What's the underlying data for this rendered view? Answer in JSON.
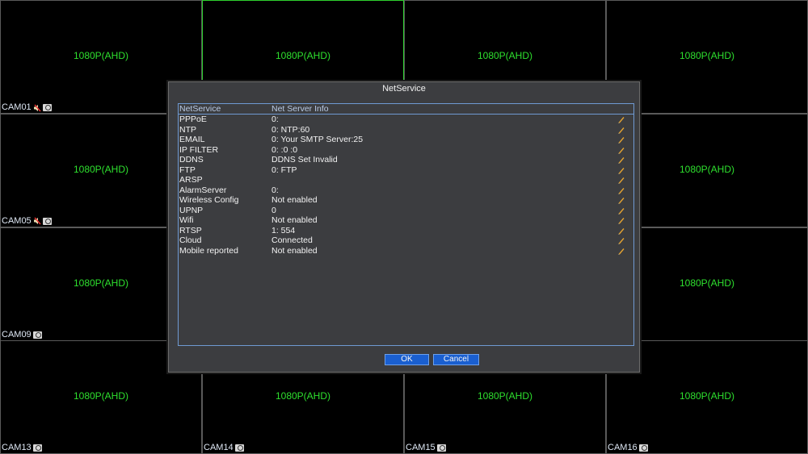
{
  "grid": {
    "cells": [
      {
        "resolution": "1080P(AHD)",
        "label": "CAM01",
        "has_audio_icon": true,
        "active": false
      },
      {
        "resolution": "1080P(AHD)",
        "label": "",
        "has_audio_icon": false,
        "active": true
      },
      {
        "resolution": "1080P(AHD)",
        "label": "",
        "has_audio_icon": false,
        "active": false
      },
      {
        "resolution": "1080P(AHD)",
        "label": "",
        "has_audio_icon": true,
        "active": false
      },
      {
        "resolution": "1080P(AHD)",
        "label": "CAM05",
        "has_audio_icon": true,
        "active": false
      },
      {
        "resolution": "",
        "label": "",
        "has_audio_icon": false,
        "active": false
      },
      {
        "resolution": "",
        "label": "",
        "has_audio_icon": false,
        "active": false
      },
      {
        "resolution": "1080P(AHD)",
        "label": "",
        "has_audio_icon": true,
        "active": false
      },
      {
        "resolution": "1080P(AHD)",
        "label": "CAM09",
        "has_audio_icon": false,
        "active": false
      },
      {
        "resolution": "",
        "label": "",
        "has_audio_icon": false,
        "active": false
      },
      {
        "resolution": "",
        "label": "",
        "has_audio_icon": false,
        "active": false
      },
      {
        "resolution": "1080P(AHD)",
        "label": "",
        "has_audio_icon": false,
        "active": false
      },
      {
        "resolution": "1080P(AHD)",
        "label": "CAM13",
        "has_audio_icon": false,
        "active": false
      },
      {
        "resolution": "1080P(AHD)",
        "label": "CAM14",
        "has_audio_icon": false,
        "active": false
      },
      {
        "resolution": "1080P(AHD)",
        "label": "CAM15",
        "has_audio_icon": false,
        "active": false
      },
      {
        "resolution": "1080P(AHD)",
        "label": "CAM16",
        "has_audio_icon": false,
        "active": false
      }
    ]
  },
  "dialog": {
    "title": "NetService",
    "header": {
      "col1": "NetService",
      "col2": "Net Server Info"
    },
    "rows": [
      {
        "service": "PPPoE",
        "info": "0:"
      },
      {
        "service": "NTP",
        "info": "0: NTP:60"
      },
      {
        "service": "EMAIL",
        "info": "0: Your SMTP Server:25"
      },
      {
        "service": "IP FILTER",
        "info": "0: :0 :0"
      },
      {
        "service": "DDNS",
        "info": "DDNS Set Invalid"
      },
      {
        "service": "FTP",
        "info": "0: FTP"
      },
      {
        "service": "ARSP",
        "info": ""
      },
      {
        "service": "AlarmServer",
        "info": "0:"
      },
      {
        "service": "Wireless Config",
        "info": "Not enabled"
      },
      {
        "service": "UPNP",
        "info": "0"
      },
      {
        "service": "Wifi",
        "info": "Not enabled"
      },
      {
        "service": "RTSP",
        "info": "1: 554"
      },
      {
        "service": "Cloud",
        "info": "Connected"
      },
      {
        "service": "Mobile reported",
        "info": "Not enabled"
      }
    ],
    "ok_label": "OK",
    "cancel_label": "Cancel"
  },
  "icons": {
    "edit": "pencil-icon",
    "audio": "mute-speaker-icon",
    "record": "camera-record-icon"
  },
  "colors": {
    "resolution_text": "#2ee02e",
    "active_border": "#2fd02f",
    "dialog_bg": "#3c3d40",
    "list_border": "#6f9ad2",
    "button_bg": "#1a5fd0",
    "edit_icon": "#e8a531"
  }
}
